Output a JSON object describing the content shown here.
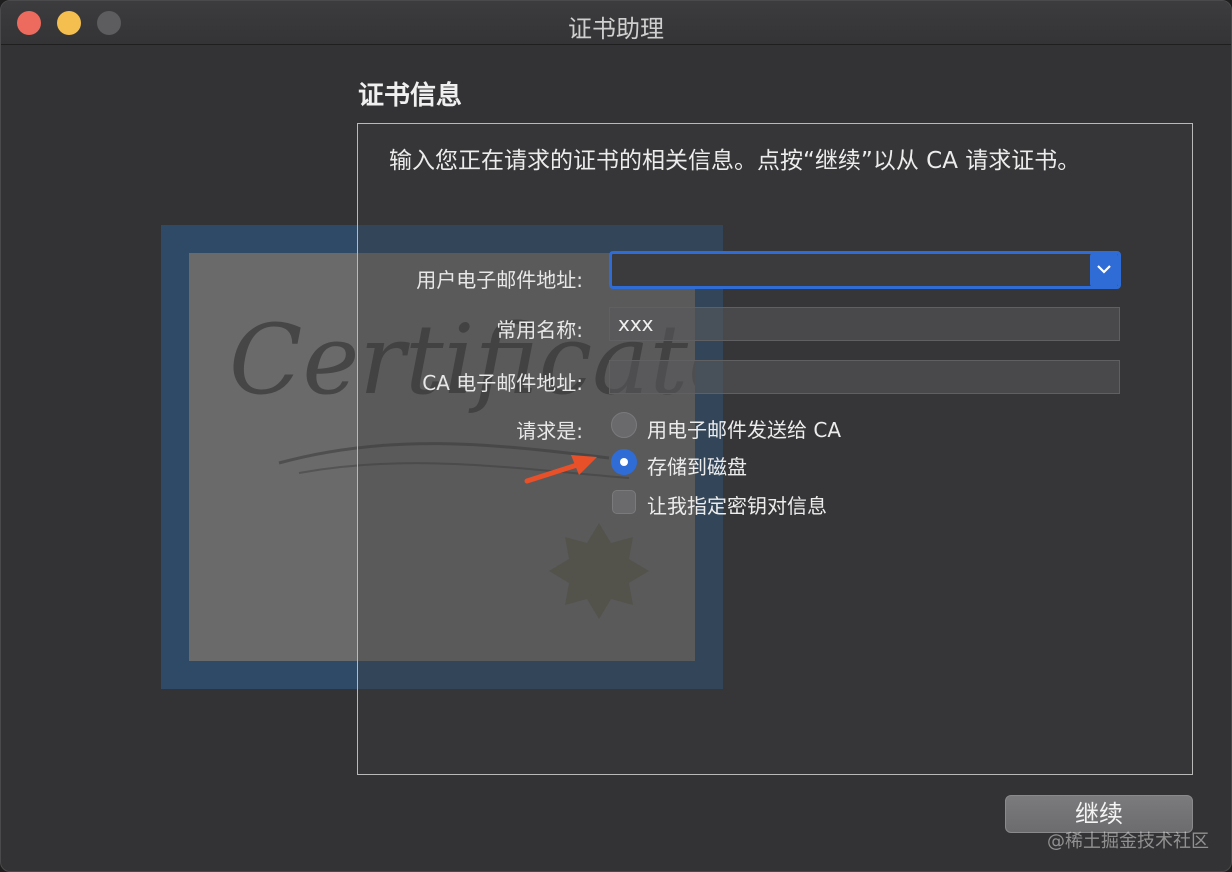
{
  "window": {
    "title": "证书助理"
  },
  "section": {
    "heading": "证书信息",
    "intro": "输入您正在请求的证书的相关信息。点按“继续”以从 CA 请求证书。"
  },
  "form": {
    "email_label": "用户电子邮件地址:",
    "email_value": "",
    "common_name_label": "常用名称:",
    "common_name_value": "xxx",
    "ca_email_label": "CA 电子邮件地址:",
    "ca_email_value": "",
    "request_label": "请求是:",
    "options": [
      {
        "label": "用电子邮件发送给 CA",
        "selected": false
      },
      {
        "label": "存储到磁盘",
        "selected": true
      }
    ],
    "specify_key_label": "让我指定密钥对信息",
    "specify_key_checked": false
  },
  "buttons": {
    "continue_label": "继续"
  },
  "decor": {
    "certificate_artwork_text": "Certificate",
    "watermark": "@稀土掘金技术社区",
    "accent_color": "#2f6cd6",
    "arrow_color": "#e8502a"
  }
}
